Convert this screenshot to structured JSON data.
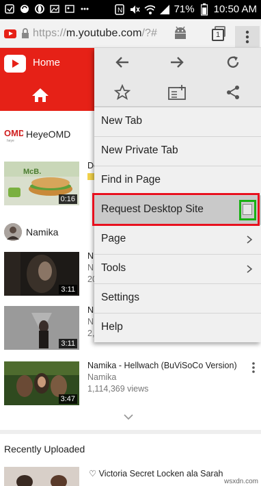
{
  "status_bar": {
    "battery_percent": "71%",
    "time": "10:50 AM"
  },
  "browser": {
    "url_prefix": "https://",
    "url_host": "m.youtube.com",
    "url_path": "/?#",
    "tab_count": "1"
  },
  "youtube": {
    "home_label": "Home",
    "channels": [
      {
        "name": "HeyeOMD"
      },
      {
        "name": "Namika"
      }
    ],
    "videos": [
      {
        "title": "De",
        "channel": "",
        "views": "",
        "duration": "0:16"
      },
      {
        "title": "N",
        "channel": "N",
        "views": "20",
        "duration": "3:11"
      },
      {
        "title": "N",
        "channel": "N",
        "views": "2,",
        "duration": "3:11"
      },
      {
        "title": "Namika - Hellwach (BuViSoCo Version)",
        "channel": "Namika",
        "views": "1,114,369 views",
        "duration": "3:47"
      }
    ],
    "recent_title": "Recently Uploaded",
    "recent_item": "♡ Victoria Secret Locken ala Sarah"
  },
  "menu": {
    "items": [
      {
        "label": "New Tab"
      },
      {
        "label": "New Private Tab"
      },
      {
        "label": "Find in Page"
      },
      {
        "label": "Request Desktop Site"
      },
      {
        "label": "Page"
      },
      {
        "label": "Tools"
      },
      {
        "label": "Settings"
      },
      {
        "label": "Help"
      }
    ]
  },
  "watermark": "wsxdn.com",
  "colors": {
    "youtube_red": "#e62117",
    "highlight_red": "#e8101e",
    "highlight_green": "#19b014"
  }
}
